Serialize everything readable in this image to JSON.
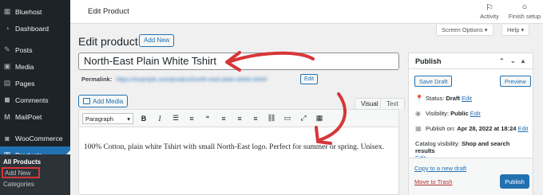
{
  "sidebar": {
    "items": [
      {
        "label": "Bluehost",
        "icon": "bluehost-icon",
        "glyph": "▦"
      },
      {
        "label": "Dashboard",
        "icon": "dashboard-icon",
        "glyph": "◔"
      },
      {
        "label": "Posts",
        "icon": "pin-icon",
        "glyph": "✎"
      },
      {
        "label": "Media",
        "icon": "media-icon",
        "glyph": "▣"
      },
      {
        "label": "Pages",
        "icon": "pages-icon",
        "glyph": "▤"
      },
      {
        "label": "Comments",
        "icon": "comments-icon",
        "glyph": "◼"
      },
      {
        "label": "MailPoet",
        "icon": "mailpoet-icon",
        "glyph": "M"
      },
      {
        "label": "WooCommerce",
        "icon": "woocommerce-icon",
        "glyph": "◙"
      },
      {
        "label": "Products",
        "icon": "products-icon",
        "glyph": "▥"
      }
    ],
    "submenu": [
      "All Products",
      "Add New",
      "Categories"
    ]
  },
  "topbar": {
    "title": "Edit Product",
    "activity": "Activity",
    "finish_setup": "Finish setup"
  },
  "screen_options": {
    "screen": "Screen Options ▾",
    "help": "Help ▾"
  },
  "main": {
    "heading": "Edit product",
    "add_new": "Add New",
    "title_value": "North-East Plain White Tshirt",
    "permalink_label": "Permalink:",
    "permalink_url": "https://example.com/product/north-east-plain-white-tshirt/",
    "edit_label": "Edit",
    "add_media": "Add Media",
    "tab_visual": "Visual",
    "tab_text": "Text",
    "format_select": "Paragraph",
    "content": "100% Cotton, plain white Tshirt with small North-East logo. Perfect for summer or spring. Unisex."
  },
  "publish": {
    "title": "Publish",
    "save_draft": "Save Draft",
    "preview": "Preview",
    "status_label": "Status:",
    "status_value": "Draft",
    "visibility_label": "Visibility:",
    "visibility_value": "Public",
    "publish_label": "Publish on:",
    "publish_value": "Apr 28, 2022 at 18:24",
    "catalog_label": "Catalog visibility:",
    "catalog_value": "Shop and search results",
    "edit": "Edit",
    "copy_draft": "Copy to a new draft",
    "trash": "Move to Trash",
    "publish_button": "Publish"
  },
  "colors": {
    "accent": "#2271b1",
    "sidebar": "#1d2327",
    "arrow": "#d63638"
  }
}
